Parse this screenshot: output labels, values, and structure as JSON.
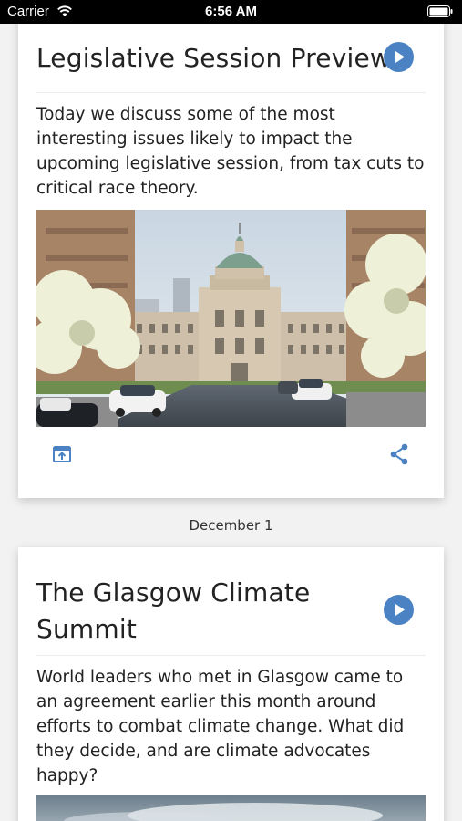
{
  "status_bar": {
    "carrier": "Carrier",
    "time": "6:56 AM"
  },
  "episodes": [
    {
      "title": "Legislative Session Preview",
      "description": "Today we discuss some of the most interesting issues likely to impact the upcoming legislative session, from tax cuts to critical race theory.",
      "image": "indiana-statehouse-photo"
    },
    {
      "title": "The Glasgow Climate Summit",
      "description": "World leaders who met in Glasgow came to an agreement earlier this month around efforts to combat climate change. What did they decide, and are climate advocates happy?",
      "image": "sky-photo"
    }
  ],
  "date_separator": "December 1",
  "icons": {
    "play": "play-icon",
    "open": "open-in-app-icon",
    "share": "share-icon",
    "wifi": "wifi-icon",
    "battery": "battery-icon"
  },
  "colors": {
    "accent": "#4b82c3",
    "background": "#f2f2f2",
    "card": "#ffffff"
  }
}
